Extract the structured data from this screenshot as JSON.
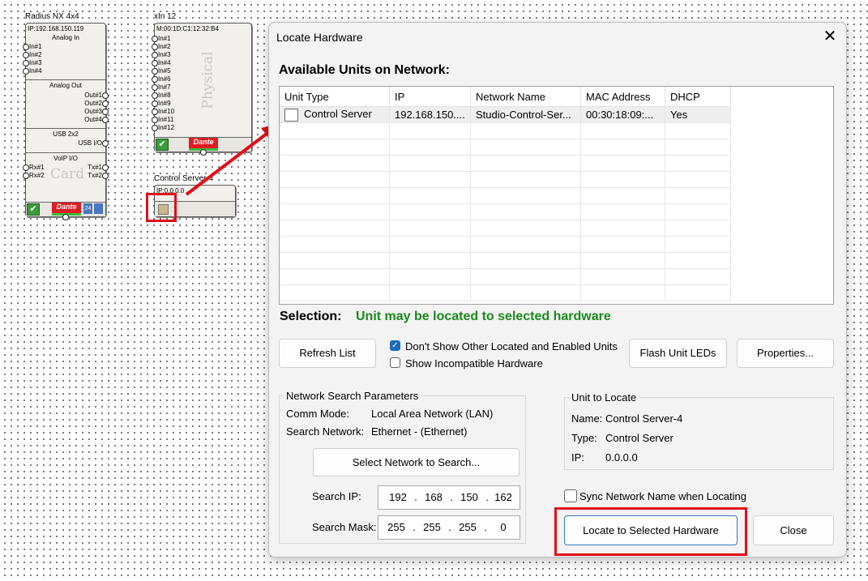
{
  "canvas": {
    "radius": {
      "title": "Radius NX 4x4",
      "ip": "IP:192.168.150.119",
      "analog_in": "Analog In",
      "inputs": [
        "In#1",
        "In#2",
        "In#3",
        "In#4"
      ],
      "analog_out": "Analog Out",
      "outputs": [
        "Out#1",
        "Out#2",
        "Out#3",
        "Out#4"
      ],
      "usb": "USB 2x2",
      "usb_io": "USB I/O",
      "voip": "VoIP I/O",
      "rx": [
        "Rx#1",
        "Rx#2"
      ],
      "tx": [
        "Tx#1",
        "Tx#2"
      ],
      "card_watermark": "Card",
      "dante": "Dante",
      "badge_24": "24"
    },
    "xin": {
      "title": "xIn 12",
      "mac": "M:00:1D:C1:12:32:B4",
      "inputs": [
        "In#1",
        "In#2",
        "In#3",
        "In#4",
        "In#5",
        "In#6",
        "In#7",
        "In#8",
        "In#9",
        "In#10",
        "In#11",
        "In#12"
      ],
      "watermark": "Physical",
      "dante": "Dante"
    },
    "control_server": {
      "title": "Control Server-4",
      "ip": "IP:0.0.0.0"
    }
  },
  "dialog": {
    "title": "Locate Hardware",
    "available_heading": "Available Units on Network:",
    "columns": [
      "Unit Type",
      "IP",
      "Network Name",
      "MAC Address",
      "DHCP"
    ],
    "rows": [
      {
        "unit_type": "Control Server",
        "ip": "192.168.150....",
        "network_name": "Studio-Control-Ser...",
        "mac": "00:30:18:09:...",
        "dhcp": "Yes",
        "checked": false
      }
    ],
    "selection_label": "Selection:",
    "selection_status": "Unit may be located to selected hardware",
    "refresh_button": "Refresh List",
    "dont_show_label": "Don't Show Other Located and Enabled Units",
    "dont_show_checked": true,
    "show_incompatible_label": "Show Incompatible Hardware",
    "show_incompatible_checked": false,
    "flash_button": "Flash Unit LEDs",
    "properties_button": "Properties...",
    "network_params": {
      "legend": "Network Search Parameters",
      "comm_mode_label": "Comm Mode:",
      "comm_mode_value": "Local Area Network (LAN)",
      "search_network_label": "Search Network:",
      "search_network_value": "Ethernet -  (Ethernet)",
      "select_button": "Select Network to Search...",
      "search_ip_label": "Search IP:",
      "search_ip": [
        "192",
        "168",
        "150",
        "162"
      ],
      "search_mask_label": "Search Mask:",
      "search_mask": [
        "255",
        "255",
        "255",
        "0"
      ]
    },
    "unit_to_locate": {
      "legend": "Unit to Locate",
      "name_label": "Name:",
      "name_value": "Control Server-4",
      "type_label": "Type:",
      "type_value": "Control Server",
      "ip_label": "IP:",
      "ip_value": "0.0.0.0"
    },
    "sync_label": "Sync Network Name when Locating",
    "sync_checked": false,
    "locate_button": "Locate to Selected Hardware",
    "close_button": "Close",
    "close_icon": "close-icon"
  },
  "colors": {
    "status_green": "#1a8a1a",
    "annotation_red": "#e0101a",
    "checkbox_blue": "#1f6bb8"
  }
}
